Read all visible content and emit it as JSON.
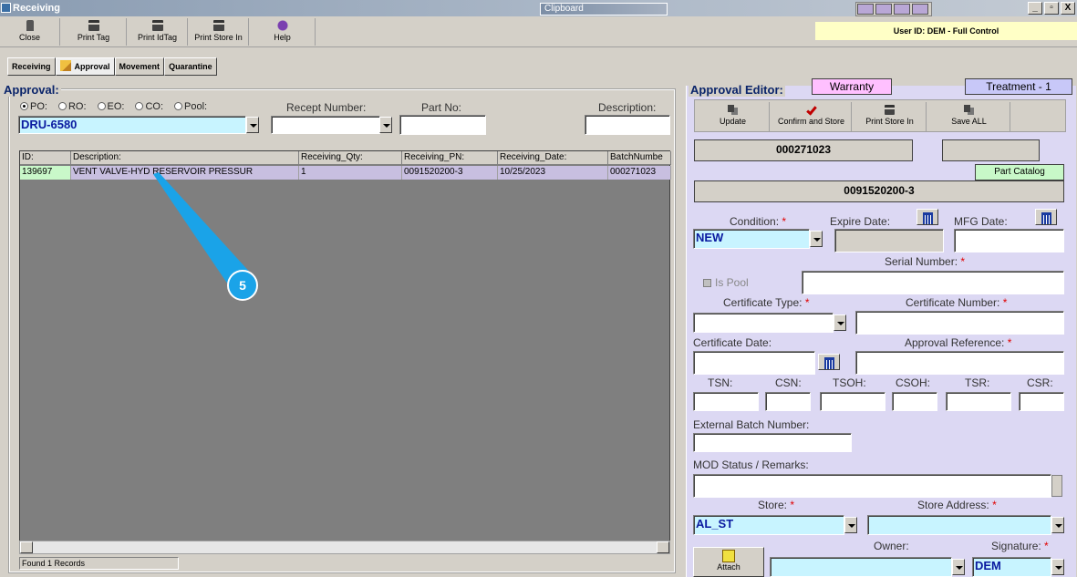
{
  "window": {
    "title": "Receiving",
    "clipboard": "Clipboard",
    "min": "_",
    "max": "▫",
    "close": "X"
  },
  "toolbar": {
    "close": "Close",
    "print_tag": "Print Tag",
    "print_idtag": "Print IdTag",
    "print_store_in": "Print Store In",
    "help": "Help"
  },
  "user_id": "User ID: DEM - Full Control",
  "tabs": [
    "Receiving",
    "Approval",
    "Movement",
    "Quarantine"
  ],
  "approval": {
    "legend": "Approval:",
    "radios": [
      "PO:",
      "RO:",
      "EO:",
      "CO:",
      "Pool:"
    ],
    "recept_label": "Recept Number:",
    "partno_label": "Part No:",
    "desc_label": "Description:",
    "po_value": "DRU-6580",
    "recept_value": "",
    "partno_value": "",
    "desc_value": ""
  },
  "grid": {
    "headers": [
      "ID:",
      "Description:",
      "Receiving_Qty:",
      "Receiving_PN:",
      "Receiving_Date:",
      "BatchNumbe"
    ],
    "rows": [
      [
        "139697",
        "VENT VALVE-HYD RESERVOIR PRESSUR",
        "1",
        "0091520200-3",
        "10/25/2023",
        "000271023"
      ]
    ]
  },
  "status": "Found 1 Records",
  "callout": {
    "number": "5"
  },
  "editor": {
    "legend": "Approval Editor:",
    "warranty": "Warranty",
    "treatment": "Treatment - 1",
    "update": "Update",
    "confirm_store": "Confirm and Store",
    "print_store_in": "Print Store In",
    "save_all": "Save ALL",
    "batch_value": "000271023",
    "batch_extra": "",
    "part_catalog": "Part Catalog",
    "pn_value": "0091520200-3",
    "condition_label": "Condition:",
    "expire_label": "Expire Date:",
    "mfg_label": "MFG Date:",
    "condition_value": "NEW",
    "serial_label": "Serial Number:",
    "is_pool": "Is Pool",
    "cert_type_label": "Certificate Type:",
    "cert_number_label": "Certificate Number:",
    "cert_date_label": "Certificate Date:",
    "approval_ref_label": "Approval Reference:",
    "tsn": "TSN:",
    "csn": "CSN:",
    "tsoh": "TSOH:",
    "csoh": "CSOH:",
    "tsr": "TSR:",
    "csr": "CSR:",
    "ext_batch_label": "External Batch Number:",
    "mod_label": "MOD Status / Remarks:",
    "store_label": "Store:",
    "store_addr_label": "Store Address:",
    "store_value": "AL_ST",
    "owner_label": "Owner:",
    "signature_label": "Signature:",
    "signature_value": "DEM",
    "attach": "Attach",
    "required": "*"
  }
}
